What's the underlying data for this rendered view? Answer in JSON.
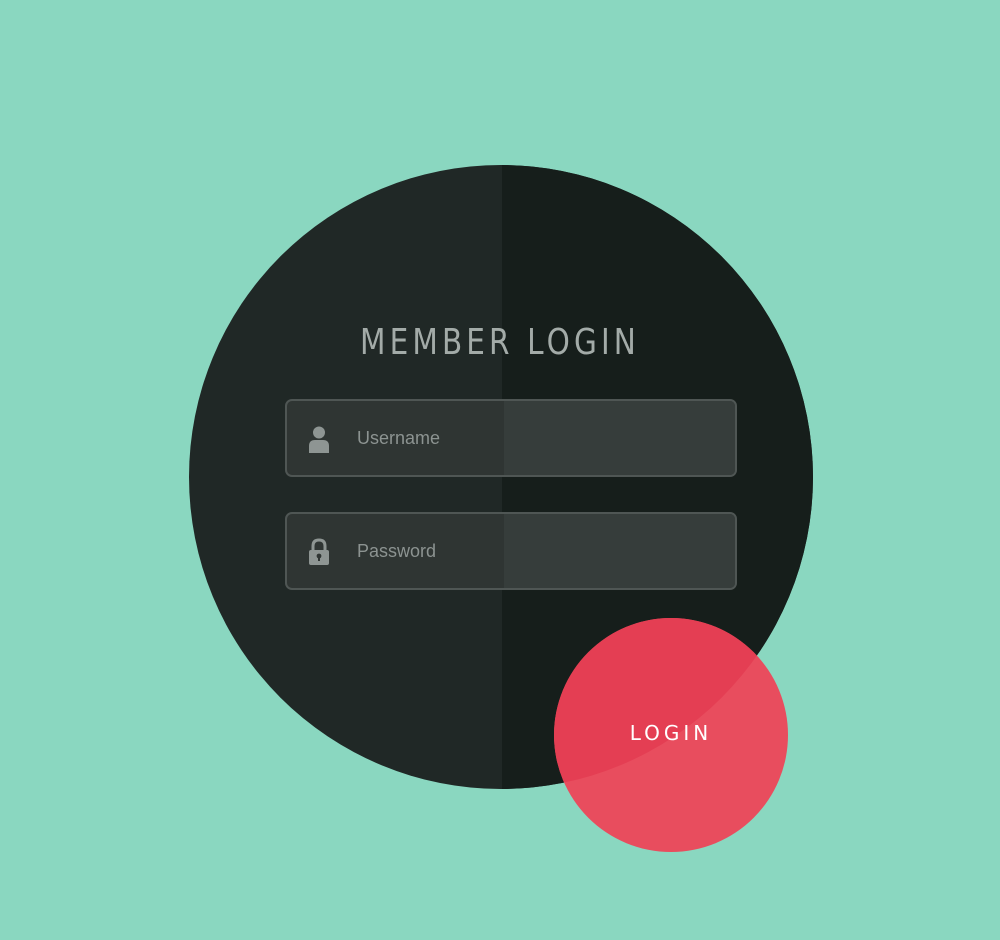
{
  "login_form": {
    "title": "MEMBER LOGIN",
    "username": {
      "placeholder": "Username",
      "icon": "user-icon"
    },
    "password": {
      "placeholder": "Password",
      "icon": "lock-icon"
    },
    "submit_label": "LOGIN"
  },
  "colors": {
    "background": "#8ad7c0",
    "panel": "#202826",
    "panel_shade": "#161e1b",
    "field_fill": "#2f3533",
    "field_border": "#4f5654",
    "accent": "#e84d5e"
  }
}
